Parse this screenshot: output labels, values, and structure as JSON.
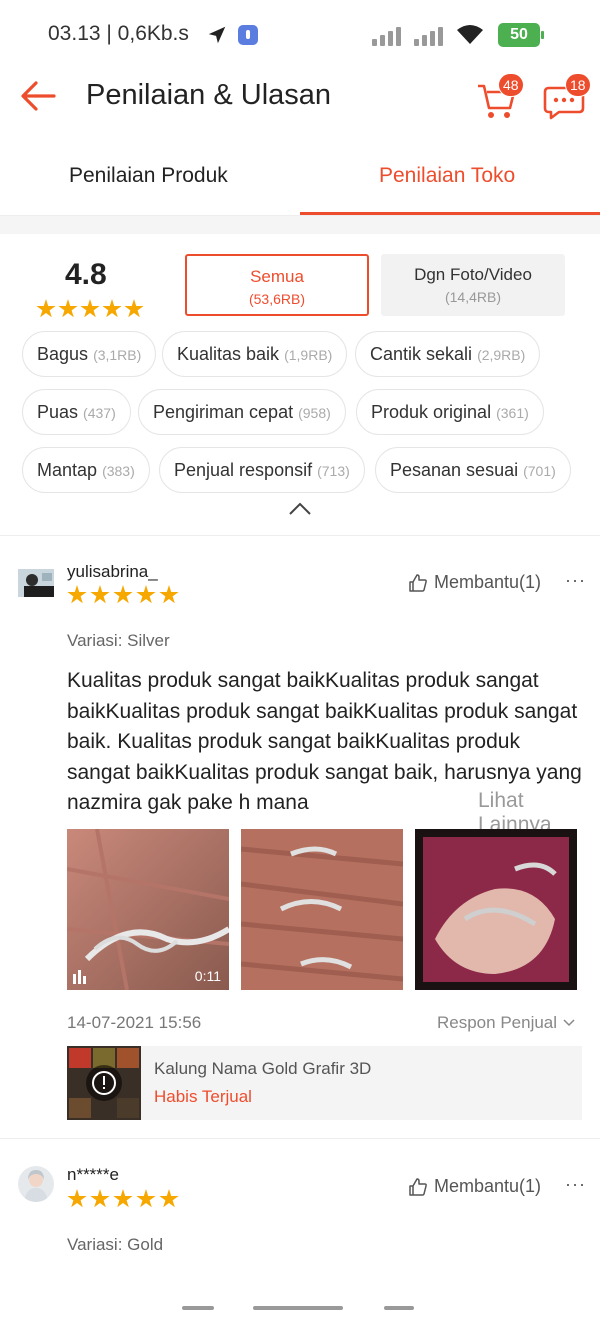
{
  "status_bar": {
    "time": "03.13 | 0,6Kb.s",
    "battery": "50"
  },
  "header": {
    "title": "Penilaian & Ulasan",
    "cart_badge": "48",
    "chat_badge": "18"
  },
  "tabs": [
    {
      "label": "Penilaian Produk",
      "active": false
    },
    {
      "label": "Penilaian Toko",
      "active": true
    }
  ],
  "summary": {
    "rating": "4.8",
    "filters": [
      {
        "label": "Semua",
        "count": "(53,6RB)",
        "active": true
      },
      {
        "label": "Dgn Foto/Video",
        "count": "(14,4RB)",
        "active": false
      }
    ]
  },
  "chips": [
    {
      "label": "Bagus",
      "count": "(3,1RB)"
    },
    {
      "label": "Kualitas baik",
      "count": "(1,9RB)"
    },
    {
      "label": "Cantik sekali",
      "count": "(2,9RB)"
    },
    {
      "label": "Puas",
      "count": "(437)"
    },
    {
      "label": "Pengiriman cepat",
      "count": "(958)"
    },
    {
      "label": "Produk original",
      "count": "(361)"
    },
    {
      "label": "Mantap",
      "count": "(383)"
    },
    {
      "label": "Penjual responsif",
      "count": "(713)"
    },
    {
      "label": "Pesanan sesuai",
      "count": "(701)"
    }
  ],
  "reviews": [
    {
      "user": "yulisabrina_",
      "stars": 5,
      "helpful": "Membantu(1)",
      "variation": "Variasi: Silver",
      "text": "Kualitas produk sangat baikKualitas produk sangat baikKualitas produk sangat baikKualitas produk sangat baik.  Kualitas produk sangat baikKualitas produk sangat baikKualitas produk sangat baik, harusnya yang nazmira gak pake h mana",
      "see_more": "Lihat Lainnya",
      "video_duration": "0:11",
      "date": "14-07-2021 15:56",
      "seller_response": "Respon Penjual",
      "product": {
        "name": "Kalung Nama Gold Grafir 3D",
        "status": "Habis Terjual"
      }
    },
    {
      "user": "n*****e",
      "stars": 5,
      "helpful": "Membantu(1)",
      "variation": "Variasi: Gold"
    }
  ],
  "colors": {
    "accent": "#ee4d2d",
    "star": "#f6a700"
  }
}
